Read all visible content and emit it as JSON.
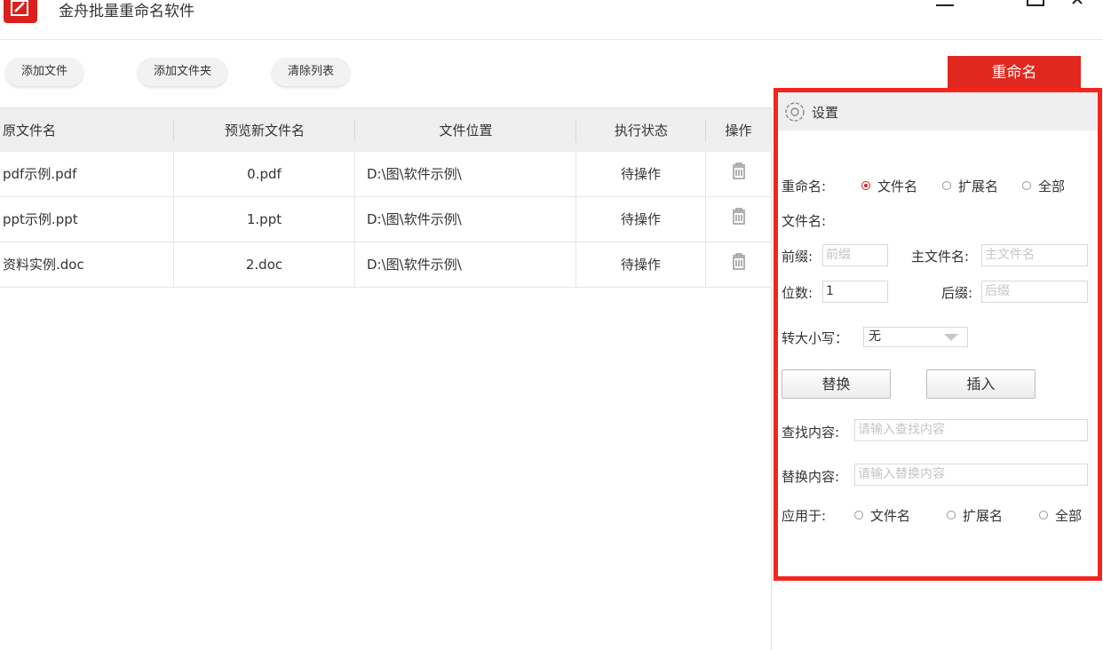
{
  "app": {
    "title": "金舟批量重命名软件"
  },
  "toolbar": {
    "add_file": "添加文件",
    "add_folder": "添加文件夹",
    "clear_list": "清除列表",
    "rename": "重命名"
  },
  "table": {
    "headers": [
      "原文件名",
      "预览新文件名",
      "文件位置",
      "执行状态",
      "操作"
    ],
    "rows": [
      {
        "original": "pdf示例.pdf",
        "preview": "0.pdf",
        "location": "D:\\图\\软件示例\\",
        "status": "待操作"
      },
      {
        "original": "ppt示例.ppt",
        "preview": "1.ppt",
        "location": "D:\\图\\软件示例\\",
        "status": "待操作"
      },
      {
        "original": "资料实例.doc",
        "preview": "2.doc",
        "location": "D:\\图\\软件示例\\",
        "status": "待操作"
      }
    ]
  },
  "settings": {
    "title": "设置",
    "rename_label": "重命名:",
    "rename_options": [
      "文件名",
      "扩展名",
      "全部"
    ],
    "rename_selected": "文件名",
    "filename_label": "文件名:",
    "prefix_label": "前缀:",
    "prefix_placeholder": "前缀",
    "main_label": "主文件名:",
    "main_placeholder": "主文件名",
    "digits_label": "位数:",
    "digits_value": "1",
    "suffix_label": "后缀:",
    "suffix_placeholder": "后缀",
    "case_label": "转大小写：",
    "case_value": "无",
    "replace_button": "替换",
    "insert_button": "插入",
    "find_label": "查找内容:",
    "find_placeholder": "请输入查找内容",
    "replace_label": "替换内容:",
    "replace_placeholder": "请输入替换内容",
    "apply_label": "应用于:",
    "apply_options": [
      "文件名",
      "扩展名",
      "全部"
    ]
  },
  "colors": {
    "accent": "#e0281f",
    "highlight_border": "#f2261d"
  }
}
